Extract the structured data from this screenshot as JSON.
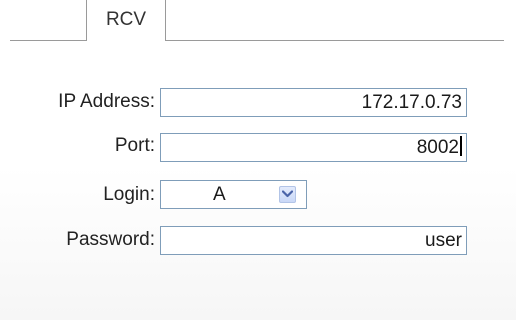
{
  "tabs": [
    {
      "label": "RCV",
      "active": true
    }
  ],
  "form": {
    "ip_address": {
      "label": "IP Address:",
      "value": "172.17.0.73"
    },
    "port": {
      "label": "Port:",
      "value": "8002"
    },
    "login": {
      "label": "Login:",
      "selected": "A",
      "icon": "chevron-down-icon"
    },
    "password": {
      "label": "Password:",
      "value": "user"
    }
  },
  "colors": {
    "field_border": "#7f9db9",
    "dropdown_button": "#c9d8f7",
    "chevron": "#4a64a8"
  }
}
